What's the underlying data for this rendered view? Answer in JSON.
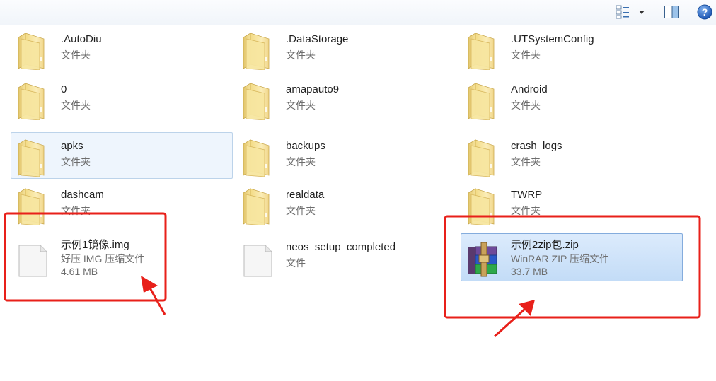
{
  "toolbar": {
    "view_icon": "change-view-icon",
    "dropdown_icon": "chevron-down-icon",
    "pane_icon": "preview-pane-icon",
    "help_icon": "help-icon",
    "help_glyph": "?"
  },
  "items": [
    {
      "name": ".AutoDiu",
      "type": "文件夹",
      "icon": "folder-icon"
    },
    {
      "name": ".DataStorage",
      "type": "文件夹",
      "icon": "folder-icon"
    },
    {
      "name": ".UTSystemConfig",
      "type": "文件夹",
      "icon": "folder-icon"
    },
    {
      "name": "0",
      "type": "文件夹",
      "icon": "folder-icon"
    },
    {
      "name": "amapauto9",
      "type": "文件夹",
      "icon": "folder-icon"
    },
    {
      "name": "Android",
      "type": "文件夹",
      "icon": "folder-icon"
    },
    {
      "name": "apks",
      "type": "文件夹",
      "icon": "folder-icon",
      "state": "hover"
    },
    {
      "name": "backups",
      "type": "文件夹",
      "icon": "folder-icon"
    },
    {
      "name": "crash_logs",
      "type": "文件夹",
      "icon": "folder-icon"
    },
    {
      "name": "dashcam",
      "type": "文件夹",
      "icon": "folder-icon"
    },
    {
      "name": "realdata",
      "type": "文件夹",
      "icon": "folder-icon"
    },
    {
      "name": "TWRP",
      "type": "文件夹",
      "icon": "folder-icon"
    },
    {
      "name": "示例1镜像.img",
      "type": "好压 IMG 压缩文件",
      "size": "4.61 MB",
      "icon": "blank-file-icon"
    },
    {
      "name": "neos_setup_completed",
      "type": "文件",
      "icon": "blank-file-icon"
    },
    {
      "name": "示例2zip包.zip",
      "type": "WinRAR ZIP 压缩文件",
      "size": "33.7 MB",
      "icon": "winrar-archive-icon",
      "state": "selected"
    }
  ],
  "colors": {
    "annotation": "#e8201a",
    "selection": "#c3dcf7",
    "hover": "#eef5fd"
  }
}
